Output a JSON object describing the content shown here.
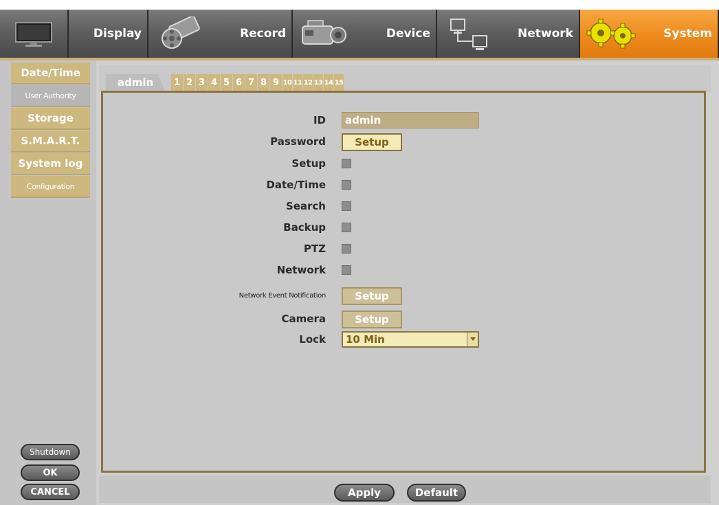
{
  "nav": {
    "tabs": [
      {
        "label": "Display",
        "icon": "monitor-icon"
      },
      {
        "label": "Record",
        "icon": "film-reel-icon"
      },
      {
        "label": "Device",
        "icon": "camcorder-icon"
      },
      {
        "label": "Network",
        "icon": "network-icon"
      },
      {
        "label": "System",
        "icon": "gears-icon"
      }
    ],
    "active_tab": "System"
  },
  "sidebar": {
    "items": [
      {
        "label": "Date/Time"
      },
      {
        "label": "User Authority"
      },
      {
        "label": "Storage"
      },
      {
        "label": "S.M.A.R.T."
      },
      {
        "label": "System log"
      },
      {
        "label": "Configuration"
      }
    ],
    "active_item": "User Authority",
    "shutdown_label": "Shutdown",
    "ok_label": "OK",
    "cancel_label": "CANCEL"
  },
  "user_tabs": {
    "admin_label": "admin",
    "numbers": [
      "1",
      "2",
      "3",
      "4",
      "5",
      "6",
      "7",
      "8",
      "9",
      "10",
      "11",
      "12",
      "13",
      "14",
      "15"
    ]
  },
  "form": {
    "id_label": "ID",
    "id_value": "admin",
    "password_label": "Password",
    "password_button": "Setup",
    "setup_label": "Setup",
    "datetime_label": "Date/Time",
    "search_label": "Search",
    "backup_label": "Backup",
    "ptz_label": "PTZ",
    "network_label": "Network",
    "net_event_label": "Network Event Notification",
    "net_event_button": "Setup",
    "camera_label": "Camera",
    "camera_button": "Setup",
    "lock_label": "Lock",
    "lock_value": "10 Min"
  },
  "footer": {
    "apply_label": "Apply",
    "default_label": "Default"
  },
  "colors": {
    "accent_orange": "#ee8a1e",
    "tan": "#cdb87f",
    "panel_border": "#8a7440",
    "background": "#d0d0d0"
  }
}
